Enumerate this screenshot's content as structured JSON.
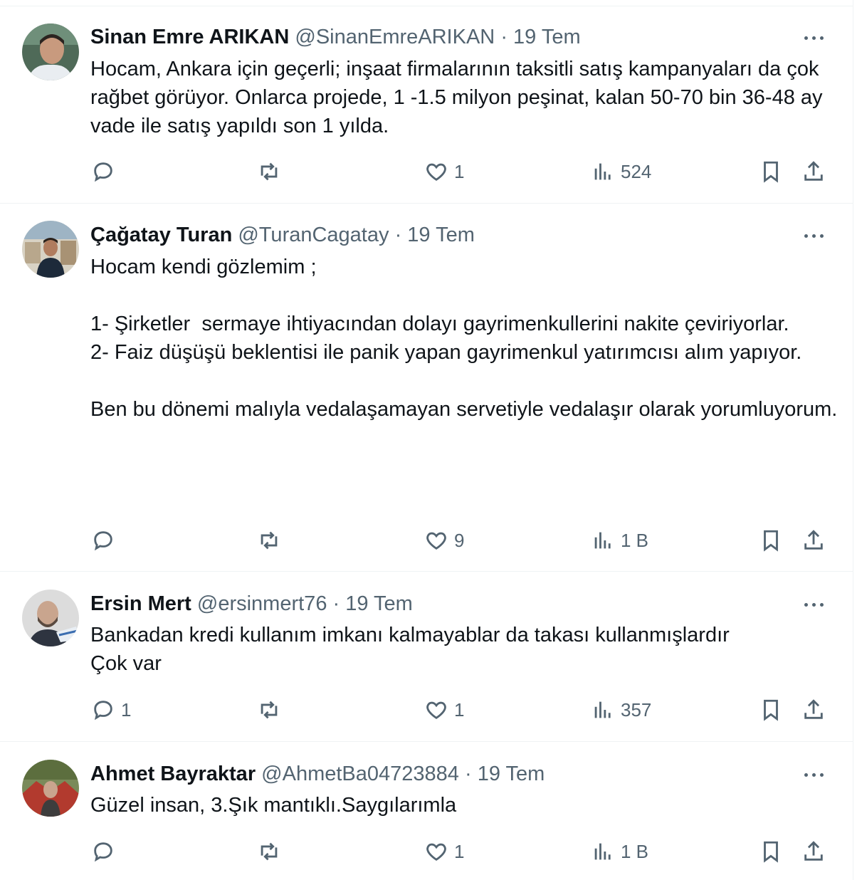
{
  "tweets": [
    {
      "name": "Sinan Emre ARIKAN",
      "handle": "@SinanEmreARIKAN",
      "sep": "·",
      "date": "19 Tem",
      "text": "Hocam, Ankara için geçerli; inşaat firmalarının taksitli satış kampanyaları da çok rağbet görüyor. Onlarca projede, 1 -1.5 milyon peşinat, kalan 50-70 bin 36-48 ay vade ile satış yapıldı son 1 yılda.",
      "replies": "",
      "retweets": "",
      "likes": "1",
      "views": "524"
    },
    {
      "name": "Çağatay Turan",
      "handle": "@TuranCagatay",
      "sep": "·",
      "date": "19 Tem",
      "text": "Hocam kendi gözlemim ;\n\n1- Şirketler  sermaye ihtiyacından dolayı gayrimenkullerini nakite çeviriyorlar.\n2- Faiz düşüşü beklentisi ile panik yapan gayrimenkul yatırımcısı alım yapıyor.\n\nBen bu dönemi malıyla vedalaşamayan servetiyle vedalaşır olarak yorumluyorum.",
      "replies": "",
      "retweets": "",
      "likes": "9",
      "views": "1 B"
    },
    {
      "name": "Ersin Mert",
      "handle": "@ersinmert76",
      "sep": "·",
      "date": "19 Tem",
      "text": "Bankadan kredi kullanım imkanı kalmayablar da takası kullanmışlardır\nÇok var",
      "replies": "1",
      "retweets": "",
      "likes": "1",
      "views": "357"
    },
    {
      "name": "Ahmet Bayraktar",
      "handle": "@AhmetBa04723884",
      "sep": "·",
      "date": "19 Tem",
      "text": "Güzel insan, 3.Şık mantıklı.Saygılarımla",
      "replies": "",
      "retweets": "",
      "likes": "1",
      "views": "1 B"
    }
  ],
  "colors": {
    "text": "#0f1419",
    "secondary": "#536471",
    "divider": "#eff3f4"
  },
  "icons": [
    "reply-icon",
    "retweet-icon",
    "like-icon",
    "views-icon",
    "bookmark-icon",
    "share-icon",
    "more-icon"
  ]
}
